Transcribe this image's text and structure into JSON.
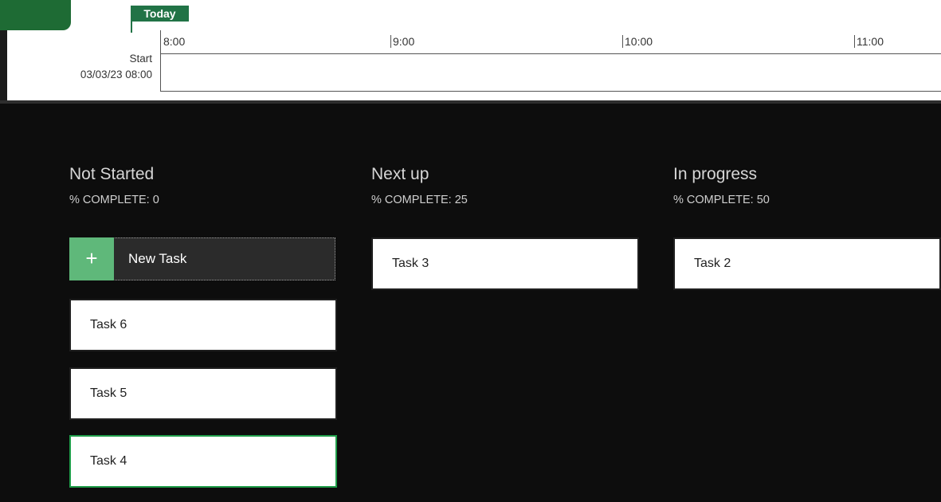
{
  "timeline": {
    "today_label": "Today",
    "start_label": "Start",
    "start_date": "03/03/23 08:00",
    "ticks": [
      "8:00",
      "9:00",
      "10:00",
      "11:00"
    ]
  },
  "columns": [
    {
      "title": "Not Started",
      "subtitle": "% COMPLETE: 0",
      "new_task_label": "New Task",
      "cards": [
        "Task 6",
        "Task 5",
        "Task 4"
      ]
    },
    {
      "title": "Next up",
      "subtitle": "% COMPLETE: 25",
      "cards": [
        "Task 3"
      ]
    },
    {
      "title": "In progress",
      "subtitle": "% COMPLETE: 50",
      "cards": [
        "Task 2"
      ]
    }
  ],
  "colors": {
    "accent_green": "#217346",
    "plus_green": "#5fb87a",
    "selected_border": "#1f9d49",
    "board_background": "#0d0d0d"
  },
  "icons": {
    "add": "plus-icon"
  }
}
